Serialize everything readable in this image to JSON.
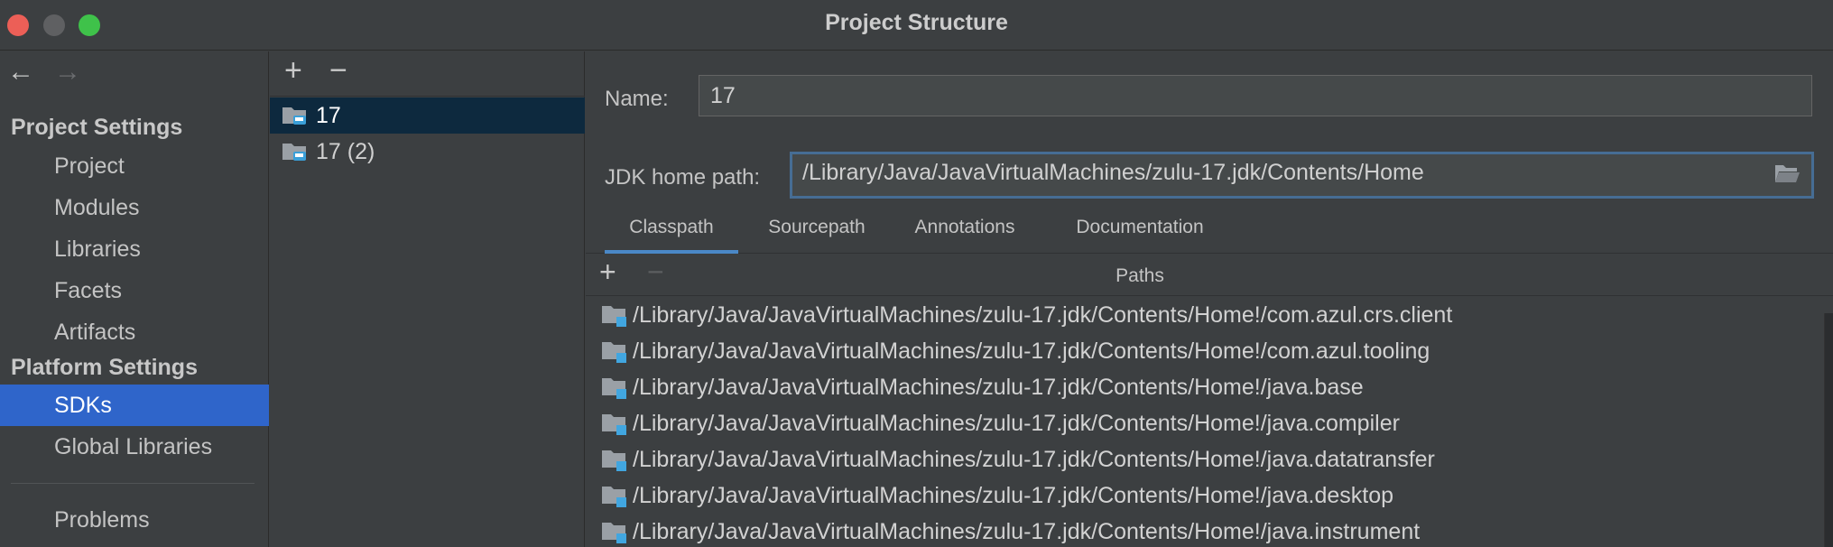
{
  "window": {
    "title": "Project Structure"
  },
  "nav": {
    "back": "←",
    "forward": "→"
  },
  "sidebar": {
    "project_settings_title": "Project Settings",
    "project_items": [
      "Project",
      "Modules",
      "Libraries",
      "Facets",
      "Artifacts"
    ],
    "platform_settings_title": "Platform Settings",
    "platform_items": [
      "SDKs",
      "Global Libraries"
    ],
    "selected": "SDKs",
    "bottom_items": [
      "Problems"
    ]
  },
  "sdk_list": {
    "add_label": "+",
    "remove_label": "−",
    "items": [
      "17",
      "17 (2)"
    ],
    "selected_index": 0
  },
  "sdk_detail": {
    "name_label": "Name:",
    "name_value": "17",
    "home_label": "JDK home path:",
    "home_value": "/Library/Java/JavaVirtualMachines/zulu-17.jdk/Contents/Home",
    "tabs": [
      "Classpath",
      "Sourcepath",
      "Annotations",
      "Documentation Paths"
    ],
    "active_tab": "Classpath",
    "add_label": "+",
    "remove_label": "−",
    "classpath": [
      "/Library/Java/JavaVirtualMachines/zulu-17.jdk/Contents/Home!/com.azul.crs.client",
      "/Library/Java/JavaVirtualMachines/zulu-17.jdk/Contents/Home!/com.azul.tooling",
      "/Library/Java/JavaVirtualMachines/zulu-17.jdk/Contents/Home!/java.base",
      "/Library/Java/JavaVirtualMachines/zulu-17.jdk/Contents/Home!/java.compiler",
      "/Library/Java/JavaVirtualMachines/zulu-17.jdk/Contents/Home!/java.datatransfer",
      "/Library/Java/JavaVirtualMachines/zulu-17.jdk/Contents/Home!/java.desktop",
      "/Library/Java/JavaVirtualMachines/zulu-17.jdk/Contents/Home!/java.instrument"
    ]
  },
  "colors": {
    "window_bg": "#3c3f41",
    "sidebar_selected": "#2f65ca",
    "list_selected": "#0d293e",
    "focus_border": "#466d94",
    "active_tab_underline": "#4a88c7",
    "traffic_close": "#ec5f57",
    "traffic_min": "#5f6062",
    "traffic_max": "#3fc24a"
  },
  "icons": {
    "sdk": "jdk-folder-icon",
    "browse": "folder-open-icon",
    "classpath_entry": "module-folder-icon"
  }
}
